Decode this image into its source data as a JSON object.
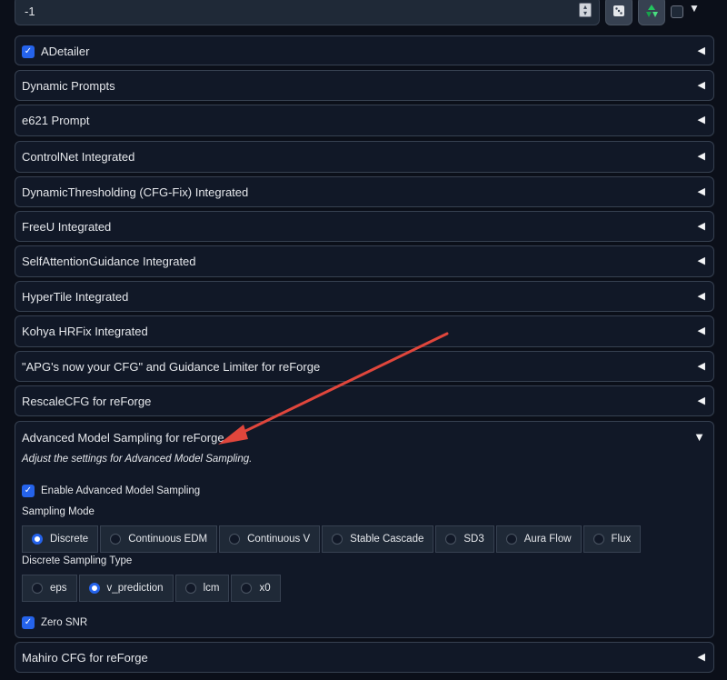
{
  "seed": {
    "value": "-1"
  },
  "toolbar": {
    "dice_icon": "dice-icon",
    "recycle_icon": "recycle-icon"
  },
  "accordions": [
    {
      "title": "ADetailer",
      "checked": true
    },
    {
      "title": "Dynamic Prompts"
    },
    {
      "title": "e621 Prompt"
    },
    {
      "title": "ControlNet Integrated"
    },
    {
      "title": "DynamicThresholding (CFG-Fix) Integrated"
    },
    {
      "title": "FreeU Integrated"
    },
    {
      "title": "SelfAttentionGuidance Integrated"
    },
    {
      "title": "HyperTile Integrated"
    },
    {
      "title": "Kohya HRFix Integrated"
    },
    {
      "title": "\"APG's now your CFG\" and Guidance Limiter for reForge"
    },
    {
      "title": "RescaleCFG for reForge"
    }
  ],
  "ams": {
    "title": "Advanced Model Sampling for reForge",
    "description": "Adjust the settings for Advanced Model Sampling.",
    "enable_label": "Enable Advanced Model Sampling",
    "sampling_mode_label": "Sampling Mode",
    "sampling_modes": [
      "Discrete",
      "Continuous EDM",
      "Continuous V",
      "Stable Cascade",
      "SD3",
      "Aura Flow",
      "Flux"
    ],
    "sampling_mode_selected": "Discrete",
    "discrete_type_label": "Discrete Sampling Type",
    "discrete_types": [
      "eps",
      "v_prediction",
      "lcm",
      "x0"
    ],
    "discrete_type_selected": "v_prediction",
    "zero_snr_label": "Zero SNR"
  },
  "mahiro": {
    "title": "Mahiro CFG for reForge"
  },
  "colors": {
    "accent": "#2563eb",
    "annotation_arrow": "#e0463c"
  }
}
